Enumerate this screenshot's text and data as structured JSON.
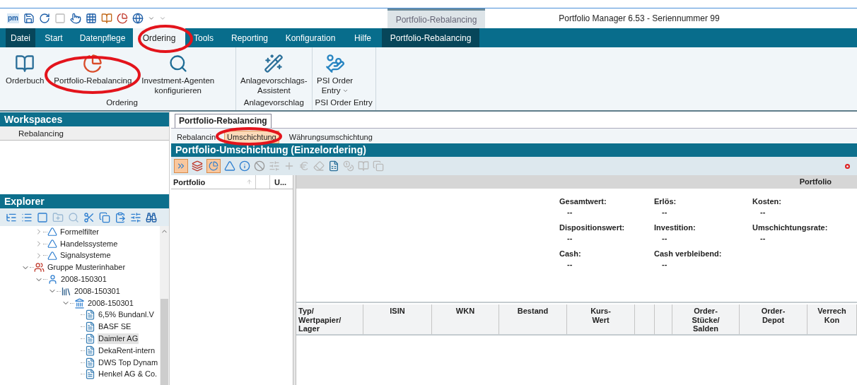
{
  "title_bar": {
    "logo": "pm",
    "context_tab": "Portfolio-Rebalancing",
    "title": "Portfolio Manager 6.53 - Seriennummer 99"
  },
  "menu": [
    {
      "label": "Datei",
      "kind": "file",
      "selected": false
    },
    {
      "label": "Start",
      "kind": "tab",
      "selected": false
    },
    {
      "label": "Datenpflege",
      "kind": "tab",
      "selected": false
    },
    {
      "label": "Ordering",
      "kind": "tab",
      "selected": true
    },
    {
      "label": "Tools",
      "kind": "tab",
      "selected": false
    },
    {
      "label": "Reporting",
      "kind": "tab",
      "selected": false
    },
    {
      "label": "Konfiguration",
      "kind": "tab",
      "selected": false
    },
    {
      "label": "Hilfe",
      "kind": "tab",
      "selected": false
    },
    {
      "label": "Portfolio-Rebalancing",
      "kind": "context",
      "selected": false
    }
  ],
  "ribbon": [
    {
      "label": "Ordering",
      "buttons": [
        {
          "label": [
            "Orderbuch"
          ],
          "dropdown": false
        },
        {
          "label": [
            "Portfolio-Rebalancing"
          ],
          "dropdown": false
        },
        {
          "label": [
            "Investment-Agenten",
            "konfigurieren"
          ],
          "dropdown": false
        }
      ]
    },
    {
      "label": "Anlagevorschlag",
      "buttons": [
        {
          "label": [
            "Anlagevorschlags-",
            "Assistent"
          ],
          "dropdown": false
        }
      ]
    },
    {
      "label": "PSI Order Entry",
      "buttons": [
        {
          "label": [
            "PSI Order",
            "Entry"
          ],
          "dropdown": true
        }
      ]
    }
  ],
  "workspaces": {
    "title": "Workspaces",
    "items": [
      {
        "label": "Rebalancing",
        "selected": true
      }
    ]
  },
  "explorer": {
    "title": "Explorer",
    "tree_continued": [
      {
        "label": "Formelfilter",
        "kind": "filter",
        "expanded": false
      },
      {
        "label": "Handelssysteme",
        "kind": "filter",
        "expanded": false
      },
      {
        "label": "Signalsysteme",
        "kind": "filter",
        "expanded": false
      }
    ],
    "tree": [
      {
        "label": "Gruppe Musterinhaber",
        "kind": "group",
        "expanded": true,
        "children": [
          {
            "label": "2008-150301",
            "kind": "person",
            "expanded": true,
            "children": [
              {
                "label": "2008-150301",
                "kind": "depot",
                "expanded": true,
                "children": [
                  {
                    "label": "2008-150301",
                    "kind": "bank",
                    "expanded": true,
                    "children": [
                      {
                        "label": "6,5% Bundanl.V",
                        "kind": "security",
                        "selected": false
                      },
                      {
                        "label": "BASF SE",
                        "kind": "security",
                        "selected": false
                      },
                      {
                        "label": "Daimler AG",
                        "kind": "security",
                        "selected": true
                      },
                      {
                        "label": "DekaRent-intern",
                        "kind": "security",
                        "selected": false
                      },
                      {
                        "label": "DWS Top Dynam",
                        "kind": "security",
                        "selected": false
                      },
                      {
                        "label": "Henkel AG & Co.",
                        "kind": "security",
                        "selected": false
                      }
                    ]
                  }
                ]
              }
            ]
          }
        ]
      }
    ]
  },
  "document": {
    "tab": "Portfolio-Rebalancing",
    "subtabs": [
      {
        "label": "Rebalancin",
        "selected": false
      },
      {
        "label": "Umschichtung",
        "selected": true
      },
      {
        "label": "Währungsumschichtung",
        "selected": false
      }
    ],
    "title": "Portfolio-Umschichtung (Einzelordering)",
    "list_columns": [
      "Portfolio",
      "U..."
    ],
    "portfolio_header": "Portfolio",
    "summary": [
      {
        "label": "Gesamtwert:",
        "value": "--"
      },
      {
        "label": "Erlös:",
        "value": "--"
      },
      {
        "label": "Kosten:",
        "value": "--"
      },
      {
        "label": "Dispositionswert:",
        "value": "--"
      },
      {
        "label": "Investition:",
        "value": "--"
      },
      {
        "label": "Umschichtungsrate:",
        "value": "--"
      },
      {
        "label": "Cash:",
        "value": "--"
      },
      {
        "label": "Cash verbleibend:",
        "value": "--"
      }
    ],
    "table_columns": [
      [
        "Typ/",
        "Wertpapier/",
        "Lager"
      ],
      [
        "ISIN"
      ],
      [
        "WKN"
      ],
      [
        "Bestand"
      ],
      [
        "Kurs-",
        "Wert"
      ],
      [],
      [],
      [
        "Order-",
        "Stücke/",
        "Salden"
      ],
      [
        "Order-",
        "Depot"
      ],
      [
        "Verrech",
        "Kon"
      ]
    ]
  }
}
